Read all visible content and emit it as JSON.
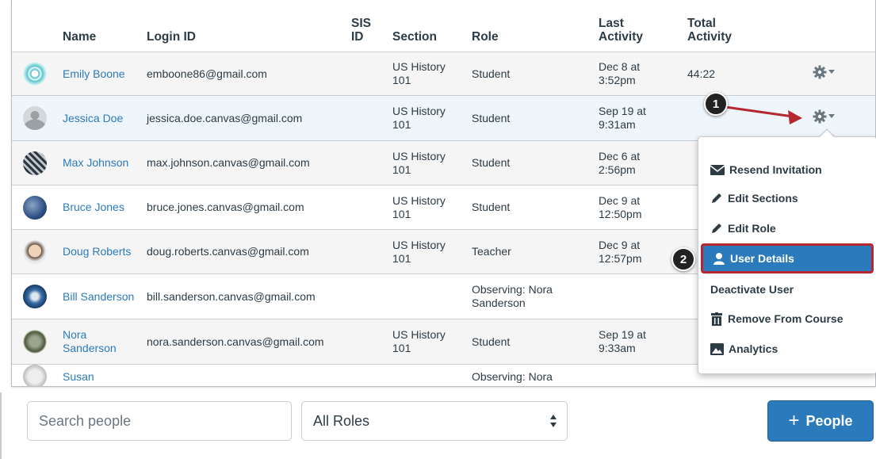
{
  "table": {
    "headers": [
      "Name",
      "Login ID",
      "SIS ID",
      "Section",
      "Role",
      "Last Activity",
      "Total Activity"
    ],
    "rows": [
      {
        "name": "Emily Boone",
        "login": "emboone86@gmail.com",
        "sis": "",
        "section": "US History 101",
        "role": "Student",
        "last": "Dec 8 at 3:52pm",
        "total": "44:22"
      },
      {
        "name": "Jessica Doe",
        "login": "jessica.doe.canvas@gmail.com",
        "sis": "",
        "section": "US History 101",
        "role": "Student",
        "last": "Sep 19 at 9:31am",
        "total": ""
      },
      {
        "name": "Max Johnson",
        "login": "max.johnson.canvas@gmail.com",
        "sis": "",
        "section": "US History 101",
        "role": "Student",
        "last": "Dec 6 at 2:56pm",
        "total": ""
      },
      {
        "name": "Bruce Jones",
        "login": "bruce.jones.canvas@gmail.com",
        "sis": "",
        "section": "US History 101",
        "role": "Student",
        "last": "Dec 9 at 12:50pm",
        "total": ""
      },
      {
        "name": "Doug Roberts",
        "login": "doug.roberts.canvas@gmail.com",
        "sis": "",
        "section": "US History 101",
        "role": "Teacher",
        "last": "Dec 9 at 12:57pm",
        "total": ""
      },
      {
        "name": "Bill Sanderson",
        "login": "bill.sanderson.canvas@gmail.com",
        "sis": "",
        "section": "",
        "role": "Observing: Nora Sanderson",
        "last": "",
        "total": ""
      },
      {
        "name": "Nora Sanderson",
        "login": "nora.sanderson.canvas@gmail.com",
        "sis": "",
        "section": "US History 101",
        "role": "Student",
        "last": "Sep 19 at 9:33am",
        "total": ""
      },
      {
        "name": "Susan",
        "login": "",
        "sis": "",
        "section": "",
        "role": "Observing: Nora",
        "last": "",
        "total": ""
      }
    ]
  },
  "menu": {
    "items": [
      {
        "label": "Resend Invitation",
        "icon": "envelope-icon"
      },
      {
        "label": "Edit Sections",
        "icon": "pencil-icon"
      },
      {
        "label": "Edit Role",
        "icon": "pencil-icon"
      },
      {
        "label": "User Details",
        "icon": "user-icon"
      },
      {
        "label": "Deactivate User",
        "icon": ""
      },
      {
        "label": "Remove From Course",
        "icon": "trash-icon"
      },
      {
        "label": "Analytics",
        "icon": "image-icon"
      }
    ]
  },
  "callouts": [
    "1",
    "2"
  ],
  "toolbar": {
    "search_placeholder": "Search people",
    "role_filter": "All Roles",
    "add_people_label": "People"
  },
  "colors": {
    "accent": "#2b7abc",
    "highlight": "#b5282f"
  }
}
